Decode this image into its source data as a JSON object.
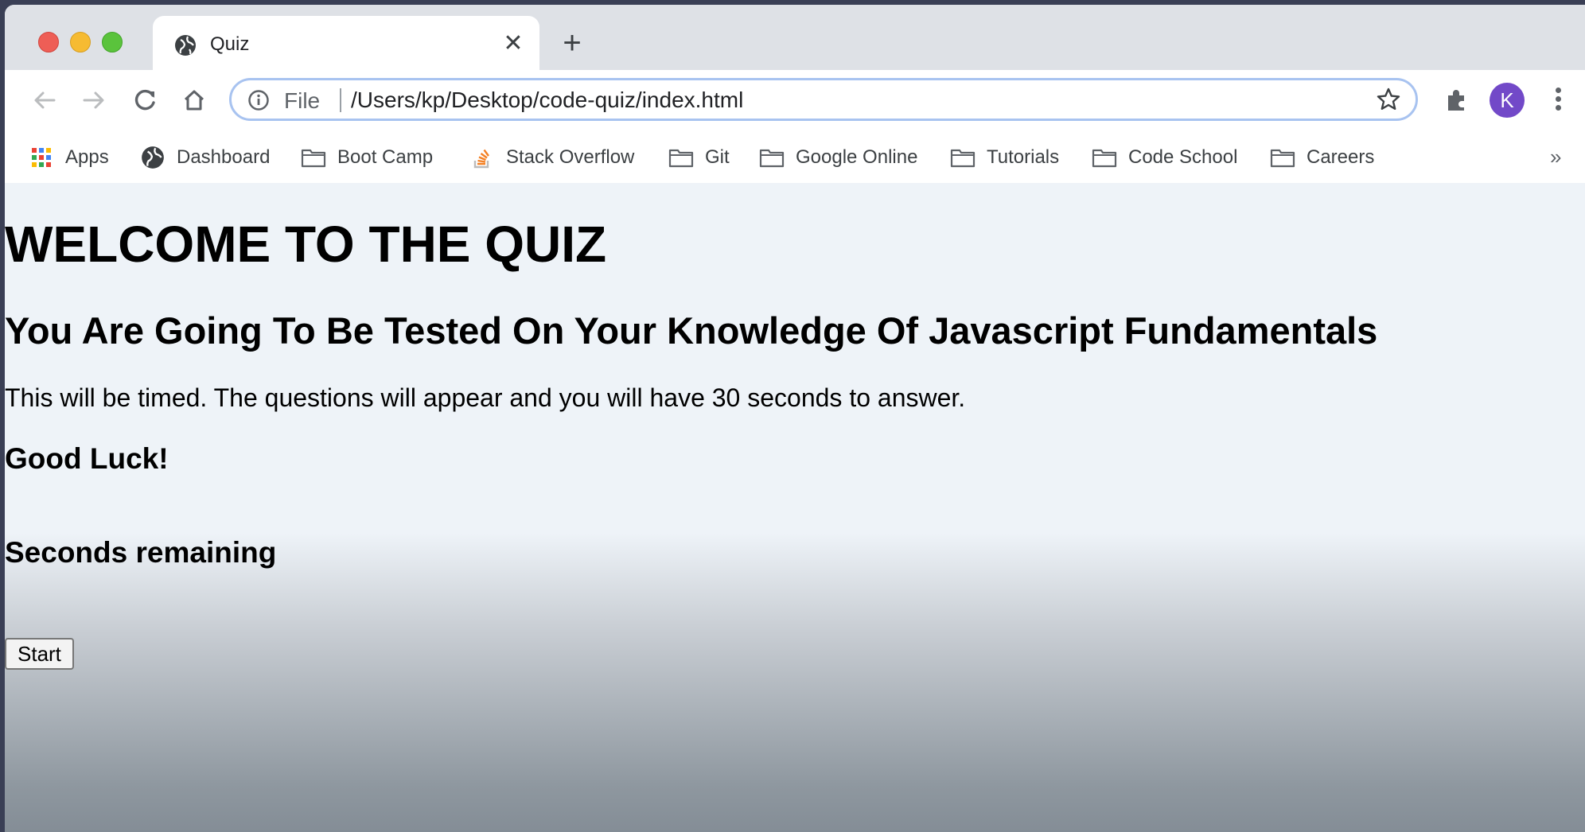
{
  "browser": {
    "tab": {
      "title": "Quiz",
      "icon": "globe-icon",
      "close_icon": "close-icon"
    },
    "new_tab_icon": "plus-icon",
    "address_bar": {
      "scheme_label": "File",
      "url": "/Users/kp/Desktop/code-quiz/index.html"
    },
    "profile_initial": "K",
    "colors": {
      "avatar": "#7249c8",
      "omnibox_focus": "#a8c3f0"
    }
  },
  "bookmarks": [
    {
      "label": "Apps",
      "icon": "apps-grid-icon"
    },
    {
      "label": "Dashboard",
      "icon": "globe-icon"
    },
    {
      "label": "Boot Camp",
      "icon": "folder-icon"
    },
    {
      "label": "Stack Overflow",
      "icon": "stack-overflow-icon"
    },
    {
      "label": "Git",
      "icon": "folder-icon"
    },
    {
      "label": "Google Online",
      "icon": "folder-icon"
    },
    {
      "label": "Tutorials",
      "icon": "folder-icon"
    },
    {
      "label": "Code School",
      "icon": "folder-icon"
    },
    {
      "label": "Careers",
      "icon": "folder-icon"
    }
  ],
  "bookmarks_overflow": "»",
  "page": {
    "heading": "WELCOME TO THE QUIZ",
    "subheading": "You Are Going To Be Tested On Your Knowledge Of Javascript Fundamentals",
    "instructions": "This will be timed. The questions will appear and you will have 30 seconds to answer.",
    "good_luck": "Good Luck!",
    "timer_label": "Seconds remaining",
    "start_button": "Start"
  }
}
